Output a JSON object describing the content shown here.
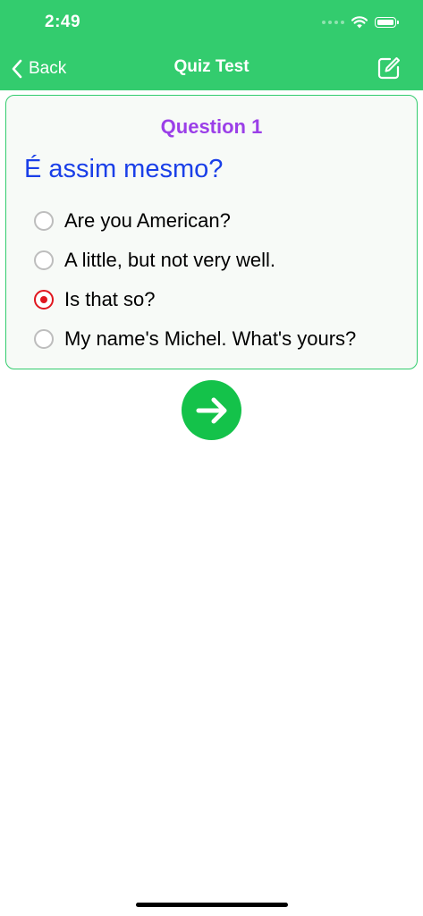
{
  "status_bar": {
    "time": "2:49",
    "icons": [
      "signal-dots-icon",
      "wifi-icon",
      "battery-icon"
    ]
  },
  "nav": {
    "back_label": "Back",
    "title": "Quiz Test",
    "edit_icon": "edit-square-icon"
  },
  "quiz": {
    "question_number": "Question 1",
    "question_text": "É assim mesmo?",
    "options": [
      {
        "label": "Are you American?",
        "selected": false
      },
      {
        "label": "A little, but not very well.",
        "selected": false
      },
      {
        "label": "Is that so?",
        "selected": true
      },
      {
        "label": "My name's Michel. What's yours?",
        "selected": false
      }
    ],
    "next_icon": "arrow-right-icon"
  },
  "colors": {
    "header": "#33CC6E",
    "question_number": "#9B3FE8",
    "question_text": "#1A3FE8",
    "selected_radio": "#E0161E",
    "next_button": "#14C24A"
  }
}
